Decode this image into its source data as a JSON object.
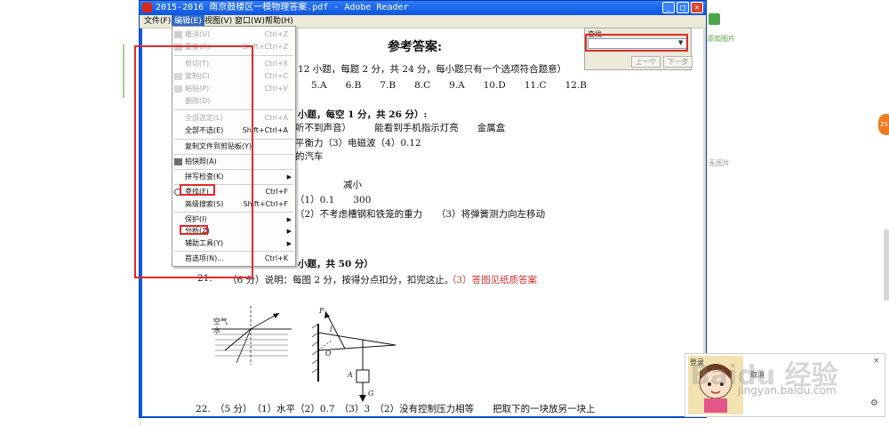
{
  "window": {
    "title": "2015-2016 南京鼓楼区一模物理答案.pdf - Adobe Reader",
    "minimize": "_",
    "maximize": "□",
    "close": "×"
  },
  "menubar": {
    "file": "文件(F)",
    "edit": "编辑(E)",
    "view": "视图(V)",
    "window": "窗口(W)",
    "help": "帮助(H)"
  },
  "find": {
    "title": "查找",
    "prev": "上一个",
    "next": "下一步"
  },
  "edit_menu": {
    "undo": {
      "label": "撤消(U)",
      "shortcut": "Ctrl+Z"
    },
    "redo": {
      "label": "重复(R)",
      "shortcut": "Shift+Ctrl+Z"
    },
    "cut": {
      "label": "剪切(T)",
      "shortcut": "Ctrl+X"
    },
    "copy": {
      "label": "复制(C)",
      "shortcut": "Ctrl+C"
    },
    "paste": {
      "label": "粘贴(P)",
      "shortcut": "Ctrl+V"
    },
    "delete": {
      "label": "删除(D)",
      "shortcut": ""
    },
    "select_all": {
      "label": "全部选定(L)",
      "shortcut": "Ctrl+A"
    },
    "deselect_all": {
      "label": "全部不选(E)",
      "shortcut": "Shift+Ctrl+A"
    },
    "copy_file": {
      "label": "复制文件到剪贴板(Y)",
      "shortcut": ""
    },
    "snapshot": {
      "label": "拍快照(A)",
      "shortcut": ""
    },
    "spell_check": {
      "label": "拼写检查(K)",
      "shortcut": ""
    },
    "find": {
      "label": "查找(F)",
      "shortcut": "Ctrl+F"
    },
    "advanced_search": {
      "label": "高级搜索(S)",
      "shortcut": "Shift+Ctrl+F"
    },
    "protect": {
      "label": "保护(I)",
      "shortcut": ""
    },
    "analyze": {
      "label": "分析(Z)",
      "shortcut": ""
    },
    "accessibility": {
      "label": "辅助工具(Y)",
      "shortcut": ""
    },
    "preferences": {
      "label": "首选项(N)...",
      "shortcut": "Ctrl+K"
    }
  },
  "document": {
    "heading": "参考答案:",
    "l1": "12 小题，每题 2 分，共 24 分，每小题只有一个选项符合题意）",
    "l2": "5.A　　6.B　　7.B　　8.C　　9.A　　10.D　　11.C　　12.B",
    "l3": "小题，每空 1 分，共 26 分）:",
    "l4": "听不到声音）　　　能看到手机指示灯亮　　金属盒",
    "l5": "平衡力（3）电磁波（4）0.12",
    "l6": "的汽车",
    "l7": "减小",
    "l8": "（1）0.1　　300",
    "l9": "（2）不考虑槽钢和铁笼的重力　　（3）将弹簧测力向左移动",
    "l10": "小题，共 50 分）",
    "q21_num": "21.",
    "q21_text": "（6 分）说明：每图 2 分，按得分点扣分，扣完这止。",
    "q21_red": "（3）答图见纸质答案",
    "q22": "22.　（5 分）　（1）水平（2）0.7　（3）3　（2）没有控制压力相等　　把取下的一块放另一块上",
    "fig1_air": "空气",
    "fig1_water": "水",
    "fig2_f": "F",
    "fig2_l": "l",
    "fig2_o": "O",
    "fig2_a": "A",
    "fig2_g": "G"
  },
  "right_panel": {
    "add_picture": "添加图片",
    "no_picture": "无图片",
    "orange": "25"
  },
  "toast": {
    "title": "登录",
    "text": "取消",
    "close": "×",
    "gear": "⚙"
  },
  "watermark": {
    "main": "Baidu 经验",
    "sub": "jingyan.baidu.com"
  },
  "colors": {
    "titlebar": "#0c55e0",
    "menu_highlight": "#316ac5",
    "annotation_red": "#e02a2a",
    "answer_red": "#d03030"
  }
}
